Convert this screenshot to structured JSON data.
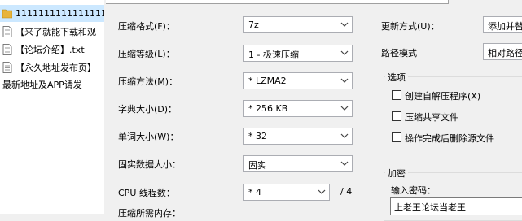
{
  "file_list": {
    "items": [
      {
        "name": "1111111111111111",
        "icon": "folder-icon",
        "selected": true
      },
      {
        "name": "【来了就能下载和观",
        "icon": "text-file-icon"
      },
      {
        "name": "【论坛介绍】.txt",
        "icon": "text-file-icon"
      },
      {
        "name": "【永久地址发布页】",
        "icon": "text-file-icon"
      },
      {
        "name": "最新地址及APP请发",
        "icon": ""
      }
    ]
  },
  "settings": {
    "format": {
      "label": "压缩格式(F)：",
      "value": "7z"
    },
    "level": {
      "label": "压缩等级(L)：",
      "value": "1 - 极速压缩"
    },
    "method": {
      "label": "压缩方法(M)：",
      "value": "* LZMA2"
    },
    "dict": {
      "label": "字典大小(D)：",
      "value": "* 256 KB"
    },
    "word": {
      "label": "单词大小(W)：",
      "value": "* 32"
    },
    "solid": {
      "label": "固实数据大小：",
      "value": "固实"
    },
    "cpu": {
      "label": "CPU 线程数：",
      "value": "* 4",
      "total": "/ 4"
    },
    "memory": {
      "label": "压缩所需内存："
    }
  },
  "right": {
    "update": {
      "label": "更新方式(U)：",
      "value": "添加并替"
    },
    "path": {
      "label": "路径模式",
      "value": "相对路径"
    },
    "options": {
      "title": "选项",
      "items": [
        {
          "label": "创建自解压程序(X)",
          "checked": false
        },
        {
          "label": "压缩共享文件",
          "checked": false
        },
        {
          "label": "操作完成后删除源文件",
          "checked": false
        }
      ]
    },
    "encrypt": {
      "title": "加密",
      "password_label": "输入密码：",
      "password_value": "上老王论坛当老王"
    }
  }
}
